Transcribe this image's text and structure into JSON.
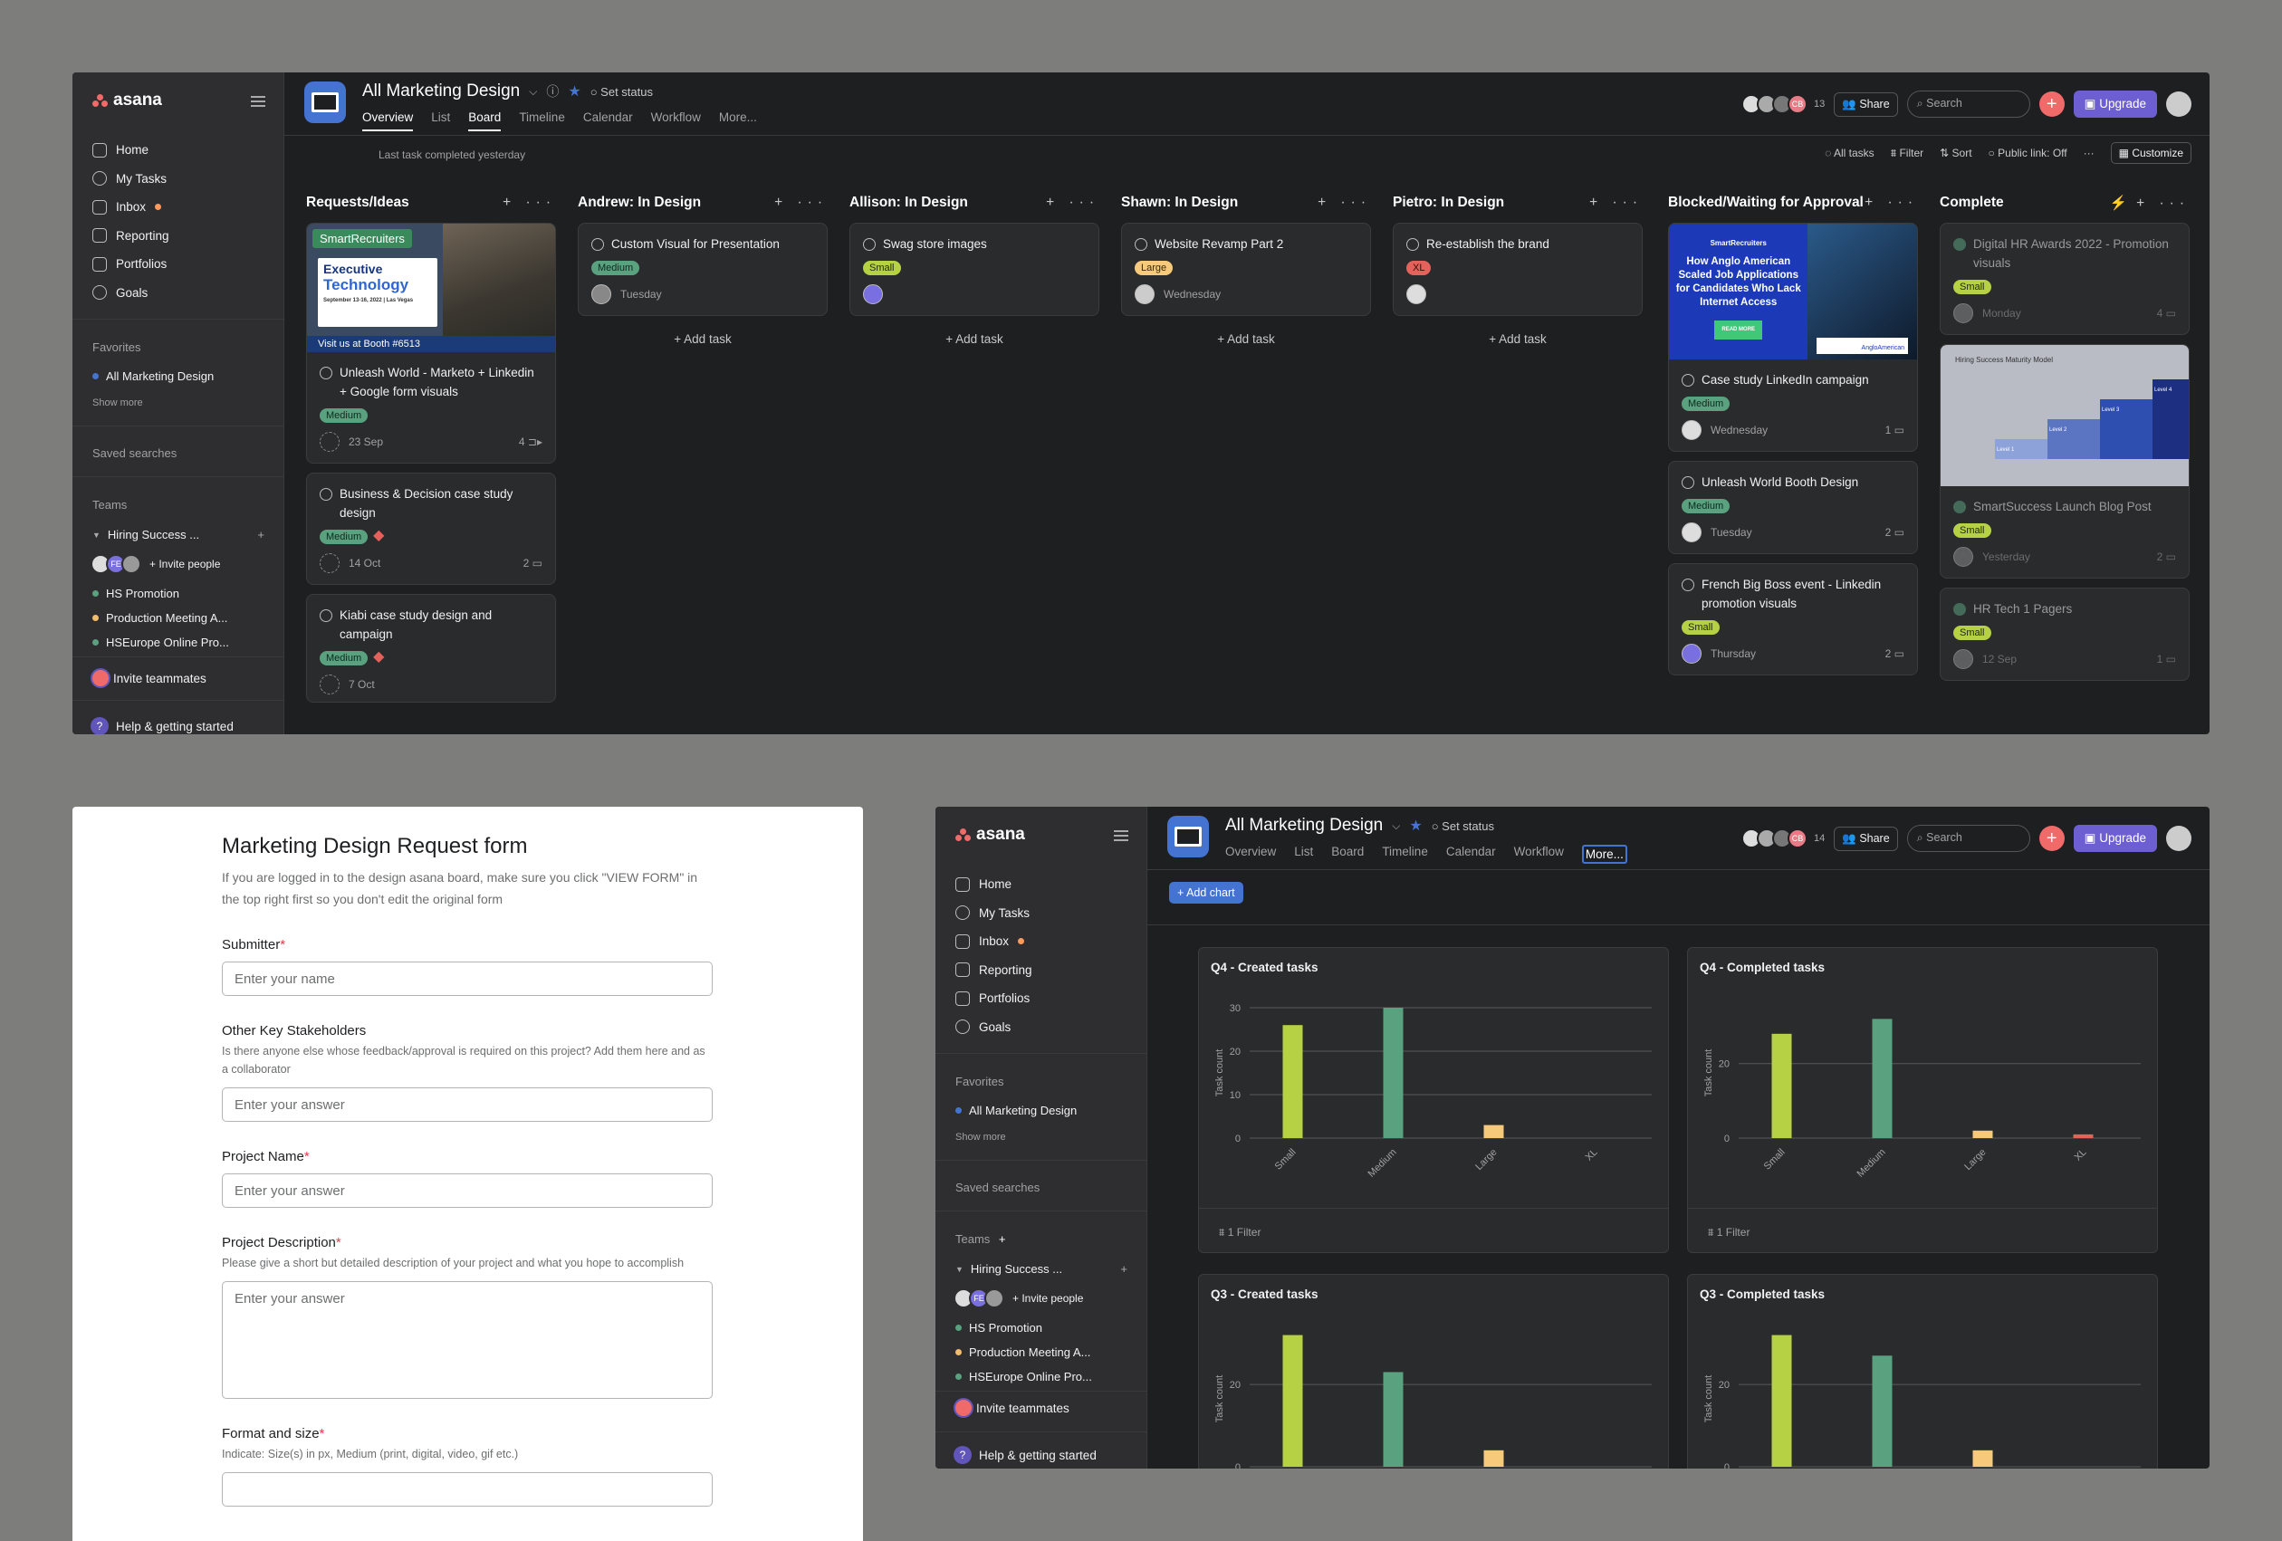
{
  "app": {
    "name": "asana"
  },
  "sidebar": {
    "nav": [
      {
        "label": "Home",
        "icon": "home-icon"
      },
      {
        "label": "My Tasks",
        "icon": "check-circle-icon"
      },
      {
        "label": "Inbox",
        "icon": "bell-icon"
      },
      {
        "label": "Reporting",
        "icon": "chart-line-icon"
      },
      {
        "label": "Portfolios",
        "icon": "folder-icon"
      },
      {
        "label": "Goals",
        "icon": "person-icon"
      }
    ],
    "favorites_label": "Favorites",
    "favorite_item": "All Marketing Design",
    "show_more": "Show more",
    "saved_searches": "Saved searches",
    "teams_label": "Teams",
    "team_name": "Hiring Success ...",
    "avatar_initials": "FE",
    "invite_people": "Invite people",
    "projects": [
      {
        "label": "HS Promotion",
        "color": "#5aa17f"
      },
      {
        "label": "Production Meeting A...",
        "color": "#f1bd6c"
      },
      {
        "label": "HSEurope Online Pro...",
        "color": "#5aa17f"
      }
    ],
    "invite_teammates": "Invite teammates",
    "help": "Help & getting started"
  },
  "header": {
    "title": "All Marketing Design",
    "set_status": "Set status",
    "tabs": [
      "Overview",
      "List",
      "Board",
      "Timeline",
      "Calendar",
      "Workflow",
      "More..."
    ],
    "member_count": "13",
    "member_count2": "14",
    "avatar_initials": "CB",
    "share": "Share",
    "search": "Search",
    "upgrade": "Upgrade"
  },
  "board": {
    "last_completed": "Last task completed yesterday",
    "toolbar": [
      "All tasks",
      "Filter",
      "Sort",
      "Public link: Off",
      "Customize"
    ],
    "add_task": "+ Add task",
    "columns": [
      {
        "title": "Requests/Ideas",
        "cards": [
          {
            "title": "Unleash World - Marketo + Linkedin + Google form visuals",
            "tag": "Medium",
            "date": "23 Sep",
            "count": "4"
          },
          {
            "title": "Business & Decision case study design",
            "tag": "Medium",
            "date": "14 Oct",
            "count": "2"
          },
          {
            "title": "Kiabi case study design and campaign",
            "tag": "Medium",
            "date": "7 Oct",
            "count": ""
          }
        ]
      },
      {
        "title": "Andrew: In Design",
        "cards": [
          {
            "title": "Custom Visual for Presentation",
            "tag": "Medium",
            "date": "Tuesday"
          }
        ]
      },
      {
        "title": "Allison: In Design",
        "cards": [
          {
            "title": "Swag store images",
            "tag": "Small",
            "date": ""
          }
        ]
      },
      {
        "title": "Shawn: In Design",
        "cards": [
          {
            "title": "Website Revamp Part 2",
            "tag": "Large",
            "date": "Wednesday"
          }
        ]
      },
      {
        "title": "Pietro: In Design",
        "cards": [
          {
            "title": "Re-establish the brand",
            "tag": "XL",
            "date": ""
          }
        ]
      },
      {
        "title": "Blocked/Waiting for Approval",
        "cards": [
          {
            "title": "Case study LinkedIn campaign",
            "tag": "Medium",
            "date": "Wednesday",
            "count": "1"
          },
          {
            "title": "Unleash World Booth Design",
            "tag": "Medium",
            "date": "Tuesday",
            "count": "2"
          },
          {
            "title": "French Big Boss event - Linkedin promotion visuals",
            "tag": "Small",
            "date": "Thursday",
            "count": "2"
          }
        ]
      },
      {
        "title": "Complete",
        "cards": [
          {
            "title": "Digital HR Awards 2022 - Promotion visuals",
            "tag": "Small",
            "date": "Monday",
            "count": "4"
          },
          {
            "title": "SmartSuccess Launch Blog Post",
            "tag": "Small",
            "date": "Yesterday",
            "count": "2"
          },
          {
            "title": "HR Tech 1 Pagers",
            "tag": "Small",
            "date": "12 Sep",
            "count": "1"
          }
        ]
      }
    ],
    "images": {
      "smartrecruiters": "SmartRecruiters",
      "exec_line1": "Executive",
      "exec_line2": "Technology",
      "exec_dates": "September 13-16, 2022 | Las Vegas",
      "booth": "Visit us at Booth #6513",
      "anglo_text": "How Anglo American Scaled Job Applications for Candidates Who Lack Internet Access",
      "anglo_button": "READ MORE",
      "anglo_logo": "AngloAmerican",
      "maturity_title": "Hiring Success Maturity Model",
      "levels": [
        "Level 1",
        "Level 2",
        "Level 3",
        "Level 4"
      ]
    }
  },
  "form": {
    "title": "Marketing Design Request form",
    "intro": "If you are logged in to the design asana board, make sure you click \"VIEW FORM\" in the top right first so you don't edit the original form",
    "fields": [
      {
        "label": "Submitter",
        "required": "*",
        "desc": "",
        "placeholder": "Enter your name"
      },
      {
        "label": "Other Key Stakeholders",
        "required": "",
        "desc": "Is there anyone else whose feedback/approval is required on this project? Add them here and as a collaborator",
        "placeholder": "Enter your answer"
      },
      {
        "label": "Project Name",
        "required": "*",
        "desc": "",
        "placeholder": "Enter your answer"
      },
      {
        "label": "Project Description",
        "required": "*",
        "desc": "Please give a short but detailed description of your project and what you hope to accomplish",
        "placeholder": "Enter your answer"
      },
      {
        "label": "Format and size",
        "required": "*",
        "desc": "Indicate: Size(s) in px, Medium (print, digital, video, gif etc.)",
        "placeholder": ""
      }
    ]
  },
  "dashboard": {
    "add_chart": "+ Add chart",
    "filter": "1 Filter"
  },
  "chart_data": [
    {
      "type": "bar",
      "title": "Q4 - Created tasks",
      "ylabel": "Task count",
      "categories": [
        "Small",
        "Medium",
        "Large",
        "XL"
      ],
      "values": [
        26,
        30,
        3,
        0
      ],
      "ylim": [
        0,
        30
      ],
      "yticks": [
        0,
        10,
        20,
        30
      ],
      "colors": [
        "#b7d145",
        "#5aa17f",
        "#f6ca7a",
        "#e3625b"
      ]
    },
    {
      "type": "bar",
      "title": "Q4 - Completed tasks",
      "ylabel": "Task count",
      "categories": [
        "Small",
        "Medium",
        "Large",
        "XL"
      ],
      "values": [
        28,
        32,
        2,
        1
      ],
      "ylim": [
        0,
        35
      ],
      "yticks": [
        0,
        20
      ],
      "colors": [
        "#b7d145",
        "#5aa17f",
        "#f6ca7a",
        "#e3625b"
      ]
    },
    {
      "type": "bar",
      "title": "Q3 - Created tasks",
      "ylabel": "Task count",
      "categories": [
        "Small",
        "Medium",
        "Large",
        "XL"
      ],
      "values": [
        32,
        23,
        4,
        0
      ],
      "ylim": [
        0,
        33
      ],
      "yticks": [
        0,
        20
      ],
      "colors": [
        "#b7d145",
        "#5aa17f",
        "#f6ca7a",
        "#e3625b"
      ]
    },
    {
      "type": "bar",
      "title": "Q3 - Completed tasks",
      "ylabel": "Task count",
      "categories": [
        "Small",
        "Medium",
        "Large",
        "XL"
      ],
      "values": [
        32,
        27,
        4,
        0
      ],
      "ylim": [
        0,
        33
      ],
      "yticks": [
        0,
        20
      ],
      "colors": [
        "#b7d145",
        "#5aa17f",
        "#f6ca7a",
        "#e3625b"
      ]
    }
  ]
}
